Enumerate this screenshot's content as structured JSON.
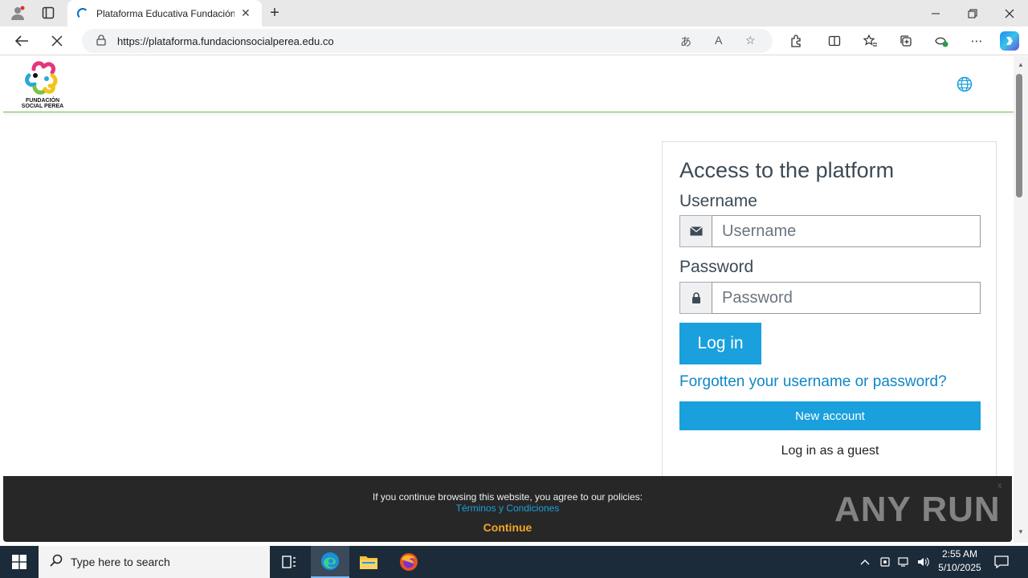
{
  "browser": {
    "tab_title": "Plataforma Educativa Fundación",
    "url": "https://plataforma.fundacionsocialperea.edu.co",
    "new_tab_symbol": "+",
    "close_symbol": "✕"
  },
  "site": {
    "logo_text_line1": "FUNDACIÓN",
    "logo_text_line2": "SOCIAL PEREA",
    "accent_color": "#1aa0dc",
    "header_border_color": "#7cc144"
  },
  "login": {
    "title": "Access to the platform",
    "username_label": "Username",
    "username_placeholder": "Username",
    "password_label": "Password",
    "password_placeholder": "Password",
    "login_button": "Log in",
    "forgot_link": "Forgotten your username or password?",
    "new_account_button": "New account",
    "guest_button": "Log in as a guest"
  },
  "cookie_bar": {
    "text": "If you continue browsing this website, you agree to our policies:",
    "link": "Términos y Condiciones",
    "continue": "Continue",
    "close": "x"
  },
  "watermark": "ANY RUN",
  "taskbar": {
    "search_placeholder": "Type here to search",
    "time": "2:55 AM",
    "date": "5/10/2025"
  }
}
